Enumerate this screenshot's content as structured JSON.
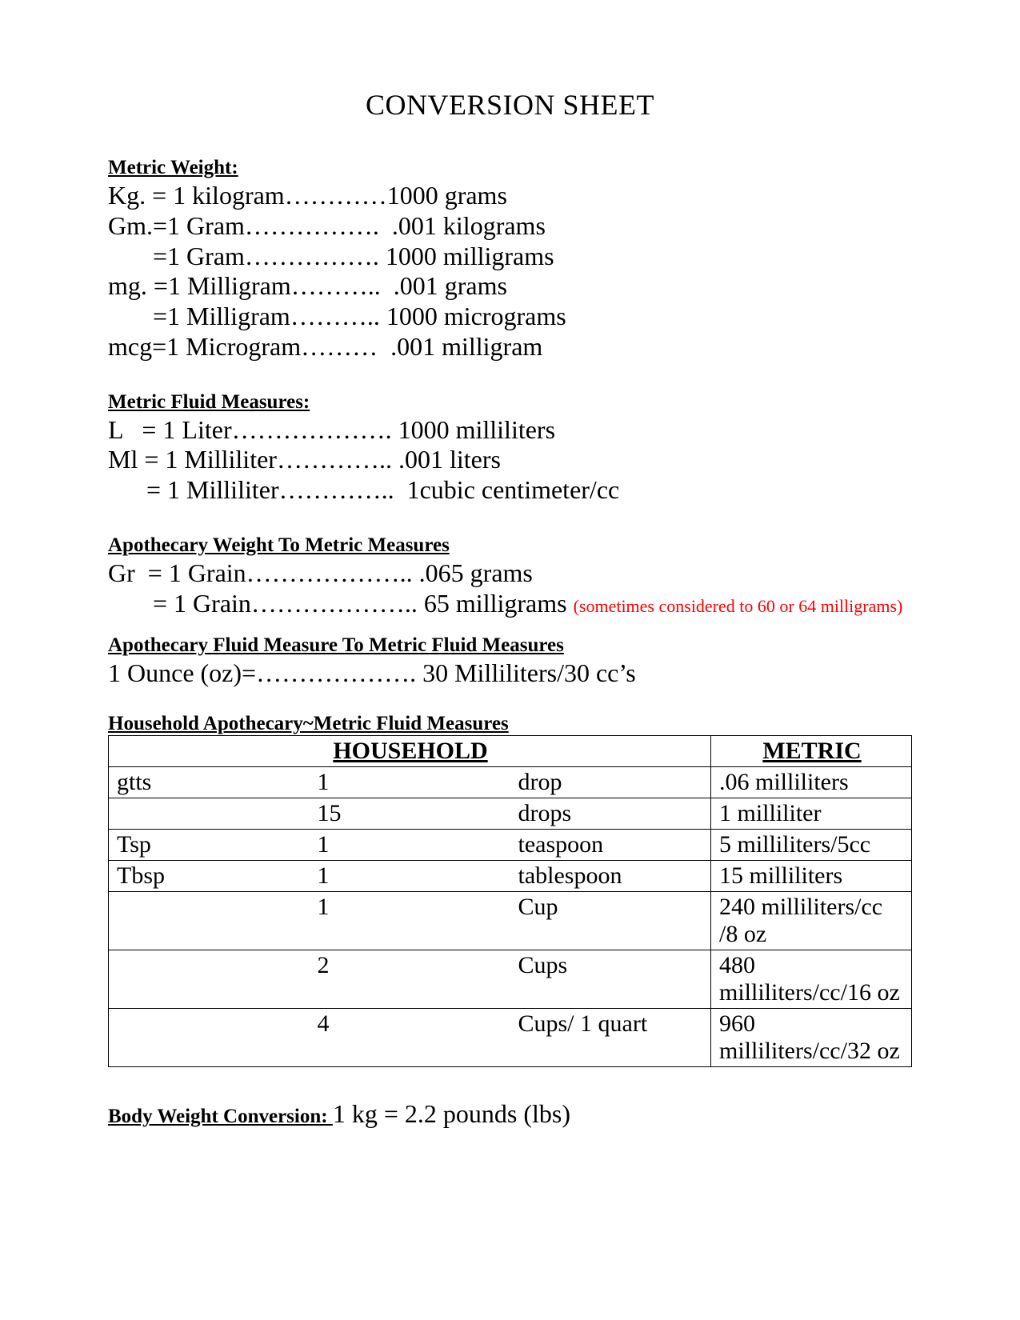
{
  "title": "CONVERSION SHEET",
  "metric_weight": {
    "heading": "Metric Weight:",
    "lines": [
      "Kg. = 1 kilogram…………1000 grams",
      "Gm.=1 Gram…………….  .001 kilograms",
      "       =1 Gram……………. 1000 milligrams",
      "mg. =1 Milligram………..  .001 grams",
      "       =1 Milligram……….. 1000 micrograms",
      "mcg=1 Microgram………  .001 milligram"
    ]
  },
  "metric_fluid": {
    "heading": "Metric Fluid Measures:",
    "lines": [
      "L   = 1 Liter………………. 1000 milliliters",
      "Ml = 1 Milliliter………….. .001 liters",
      "      = 1 Milliliter…………..  1cubic centimeter/cc"
    ]
  },
  "apoth_weight": {
    "heading": "Apothecary Weight To Metric Measures",
    "lines": [
      "Gr  = 1 Grain……………….. .065 grams",
      "       = 1 Grain……………….. 65 milligrams "
    ],
    "note": "(sometimes considered to 60 or 64 milligrams)"
  },
  "apoth_fluid": {
    "heading": "Apothecary Fluid Measure To Metric Fluid Measures",
    "line": "1 Ounce (oz)=………………. 30 Milliliters/30 cc’s"
  },
  "household": {
    "heading": "Household Apothecary~Metric Fluid Measures",
    "col_household": "HOUSEHOLD",
    "col_metric": "METRIC",
    "rows": [
      {
        "abbr": "gtts",
        "qty": "1",
        "unit": "drop",
        "metric": ".06 milliliters"
      },
      {
        "abbr": "",
        "qty": "15",
        "unit": "drops",
        "metric": "1 milliliter"
      },
      {
        "abbr": "Tsp",
        "qty": "1",
        "unit": "teaspoon",
        "metric": "5 milliliters/5cc"
      },
      {
        "abbr": "Tbsp",
        "qty": "1",
        "unit": "tablespoon",
        "metric": "15 milliliters"
      },
      {
        "abbr": "",
        "qty": "1",
        "unit": "Cup",
        "metric": "240 milliliters/cc /8 oz"
      },
      {
        "abbr": "",
        "qty": "2",
        "unit": "Cups",
        "metric": "480 milliliters/cc/16 oz"
      },
      {
        "abbr": "",
        "qty": "4",
        "unit": "Cups/ 1 quart",
        "metric": "960 milliliters/cc/32 oz"
      }
    ]
  },
  "body_weight": {
    "label": "Body Weight Conversion:  ",
    "value": " 1 kg = 2.2 pounds (lbs)"
  }
}
